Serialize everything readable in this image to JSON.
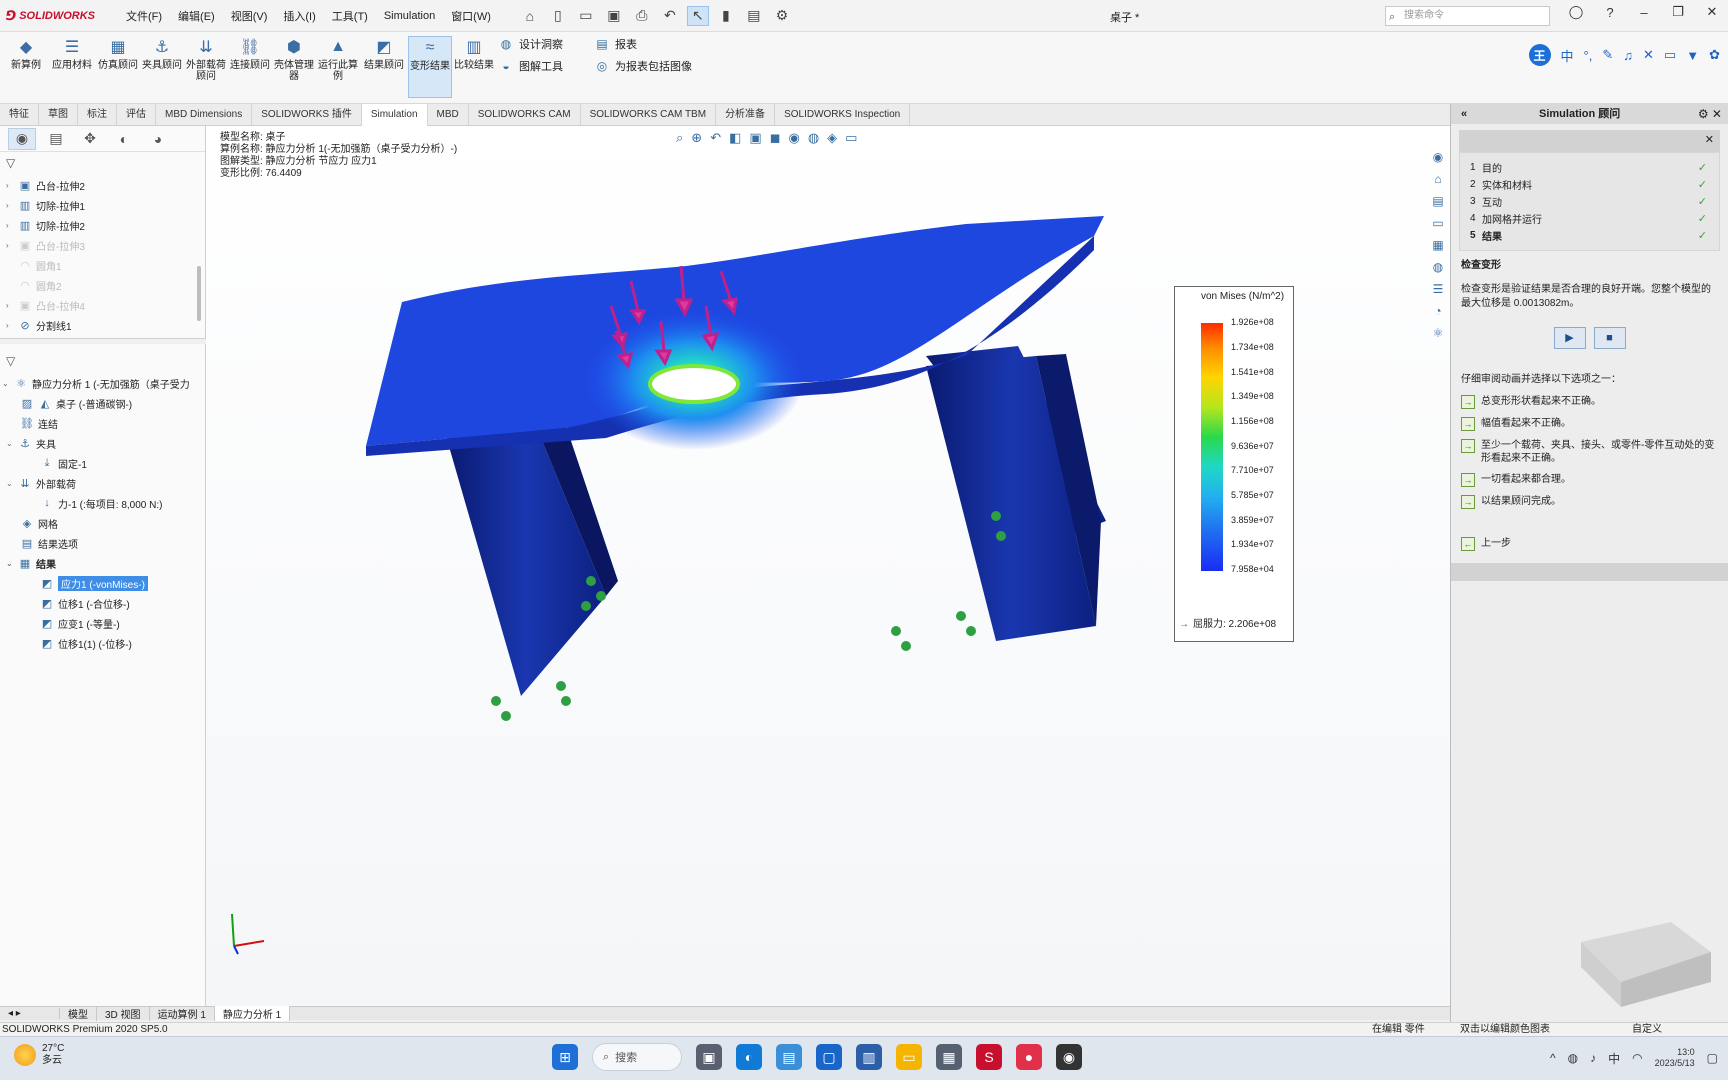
{
  "titlebar": {
    "logo_text": "SOLIDWORKS",
    "menus": [
      "文件(F)",
      "编辑(E)",
      "视图(V)",
      "插入(I)",
      "工具(T)",
      "Simulation",
      "窗口(W)"
    ],
    "doc_title": "桌子 *",
    "search_placeholder": "搜索命令"
  },
  "ribbon": {
    "buttons": [
      "新算例",
      "应用材料",
      "仿真顾问",
      "夹具顾问",
      "外部载荷顾问",
      "连接顾问",
      "壳体管理器",
      "运行此算例",
      "结果顾问",
      "变形结果",
      "比较结果"
    ],
    "small": [
      "设计洞察",
      "图解工具",
      "报表",
      "为报表包括图像"
    ],
    "ime_char": "王",
    "ime_lang": "中"
  },
  "tabs": {
    "items": [
      "特征",
      "草图",
      "标注",
      "评估",
      "MBD Dimensions",
      "SOLIDWORKS 插件",
      "Simulation",
      "MBD",
      "SOLIDWORKS CAM",
      "SOLIDWORKS CAM TBM",
      "分析准备",
      "SOLIDWORKS Inspection"
    ],
    "active": "Simulation"
  },
  "feature_tree": {
    "items": [
      "凸台-拉伸2",
      "切除-拉伸1",
      "切除-拉伸2",
      "凸台-拉伸3",
      "圆角1",
      "圆角2",
      "凸台-拉伸4",
      "分割线1"
    ]
  },
  "sim_tree": {
    "study": "静应力分析 1 (-无加强筋（桌子受力",
    "part": "桌子 (-普通碳钢-)",
    "connections": "连结",
    "fixtures": "夹具",
    "fixed": "固定-1",
    "loads": "外部载荷",
    "force": "力-1 (:每项目: 8,000 N:)",
    "mesh": "网格",
    "result_options": "结果选项",
    "results": "结果",
    "stress": "应力1 (-vonMises-)",
    "disp": "位移1 (-合位移-)",
    "strain": "应变1 (-等量-)",
    "disp2": "位移1(1) (-位移-)"
  },
  "viewport": {
    "model_name": "模型名称: 桌子",
    "study_name": "算例名称: 静应力分析 1(-无加强筋（桌子受力分析）-)",
    "plot_type": "图解类型: 静应力分析 节应力 应力1",
    "deform_scale": "变形比例: 76.4409"
  },
  "legend": {
    "title": "von Mises (N/m^2)",
    "ticks": [
      "1.926e+08",
      "1.734e+08",
      "1.541e+08",
      "1.349e+08",
      "1.156e+08",
      "9.636e+07",
      "7.710e+07",
      "5.785e+07",
      "3.859e+07",
      "1.934e+07",
      "7.958e+04"
    ],
    "yield": "屈服力: 2.206e+08",
    "colors": [
      "#ff2a00",
      "#ffd400",
      "#29d94a",
      "#22b0f0",
      "#1a2cf5"
    ]
  },
  "taskpane": {
    "header": "Simulation 顾问",
    "steps": [
      {
        "num": "1",
        "label": "目的"
      },
      {
        "num": "2",
        "label": "实体和材料"
      },
      {
        "num": "3",
        "label": "互动"
      },
      {
        "num": "4",
        "label": "加网格并运行"
      },
      {
        "num": "5",
        "label": "结果"
      }
    ],
    "section_title": "检查变形",
    "section_text": "检查变形是验证结果是否合理的良好开端。您整个模型的最大位移是 0.0013082m。",
    "prompt": "仔细审阅动画并选择以下选项之一：",
    "options": [
      "总变形形状看起来不正确。",
      "幅值看起来不正确。",
      "至少一个载荷、夹具、接头、或零件-零件互动处的变形看起来不正确。",
      "一切看起来都合理。",
      "以结果顾问完成。"
    ],
    "prev": "上一步"
  },
  "bottom_tabs": [
    "模型",
    "3D 视图",
    "运动算例 1",
    "静应力分析 1"
  ],
  "status": {
    "left": "SOLIDWORKS Premium 2020 SP5.0",
    "m1": "在编辑 零件",
    "m2": "双击以编辑颜色图表",
    "m3": "自定义"
  },
  "taskbar": {
    "temp": "27°C",
    "weather": "多云",
    "search": "搜索",
    "ime": "中",
    "time": "13:0",
    "date": "2023/5/13"
  }
}
